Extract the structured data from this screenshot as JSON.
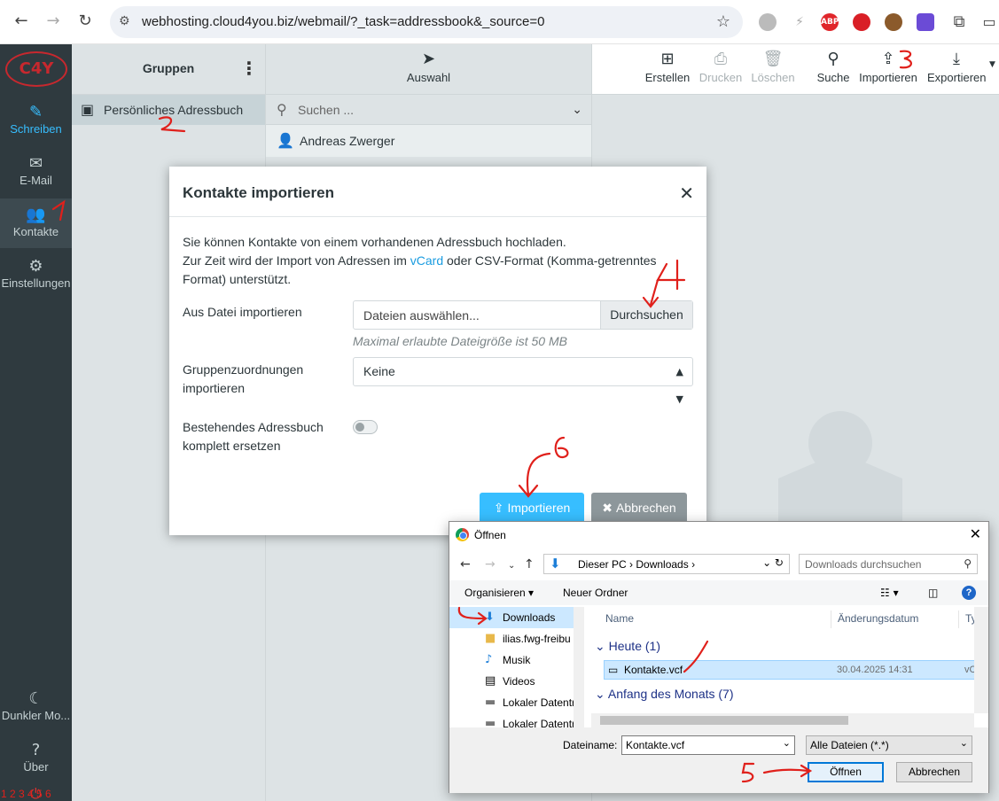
{
  "browser": {
    "url": "webhosting.cloud4you.biz/webmail/?_task=addressbook&_source=0",
    "extensions": [
      "ABP"
    ]
  },
  "sidebar": {
    "logo": "C4Y",
    "items": [
      {
        "label": "Schreiben",
        "icon": "edit-icon"
      },
      {
        "label": "E-Mail",
        "icon": "envelope-icon"
      },
      {
        "label": "Kontakte",
        "icon": "users-icon"
      },
      {
        "label": "Einstellungen",
        "icon": "gear-icon"
      },
      {
        "label": "Dunkler Mo...",
        "icon": "moon-icon"
      },
      {
        "label": "Über",
        "icon": "question-icon"
      }
    ]
  },
  "groups": {
    "title": "Gruppen",
    "items": [
      {
        "label": "Persönliches Adressbuch"
      }
    ]
  },
  "contacts": {
    "select_label": "Auswahl",
    "search_placeholder": "Suchen ...",
    "items": [
      {
        "name": "Andreas Zwerger"
      }
    ]
  },
  "toolbar": {
    "create": "Erstellen",
    "print": "Drucken",
    "delete": "Löschen",
    "search": "Suche",
    "import": "Importieren",
    "export": "Exportieren"
  },
  "import_dialog": {
    "title": "Kontakte importieren",
    "intro_line1": "Sie können Kontakte von einem vorhandenen Adressbuch hochladen.",
    "intro_line2_pre": "Zur Zeit wird der Import von Adressen im ",
    "intro_link": "vCard",
    "intro_line2_post": " oder CSV-Format (Komma-getrenntes Format) unterstützt.",
    "file_label": "Aus Datei importieren",
    "file_placeholder": "Dateien auswählen...",
    "browse_label": "Durchsuchen",
    "size_hint": "Maximal erlaubte Dateigröße ist 50 MB",
    "groups_label": "Gruppenzuordnungen importieren",
    "groups_value": "Keine",
    "replace_label": "Bestehendes Adressbuch komplett ersetzen",
    "replace_enabled": false,
    "import_button": "Importieren",
    "cancel_button": "Abbrechen"
  },
  "file_dialog": {
    "title": "Öffnen",
    "path": [
      "Dieser PC",
      "Downloads"
    ],
    "search_placeholder": "Downloads durchsuchen",
    "organize": "Organisieren",
    "new_folder": "Neuer Ordner",
    "tree": [
      {
        "label": "Downloads",
        "icon": "download-arrow-icon",
        "selected": true
      },
      {
        "label": "ilias.fwg-freibu",
        "icon": "folder-icon"
      },
      {
        "label": "Musik",
        "icon": "music-icon"
      },
      {
        "label": "Videos",
        "icon": "film-icon"
      },
      {
        "label": "Lokaler Datentr",
        "icon": "drive-icon"
      },
      {
        "label": "Lokaler Datentr",
        "icon": "drive-icon"
      }
    ],
    "columns": {
      "name": "Name",
      "date": "Änderungsdatum",
      "type": "Ty"
    },
    "groups": [
      {
        "label": "Heute (1)"
      },
      {
        "label": "Anfang des Monats (7)"
      }
    ],
    "files": [
      {
        "name": "Kontakte.vcf",
        "date": "30.04.2025 14:31",
        "type": "vC"
      }
    ],
    "filename_label": "Dateiname:",
    "filename_value": "Kontakte.vcf",
    "filetype_value": "Alle Dateien (*.*)",
    "open_button": "Öffnen",
    "cancel_button": "Abbrechen"
  },
  "annotations": [
    "1",
    "2",
    "3",
    "4",
    "5",
    "6"
  ],
  "colors": {
    "accent": "#37beff",
    "annotation": "#e0201b",
    "sidebar": "#2f3a3f"
  }
}
